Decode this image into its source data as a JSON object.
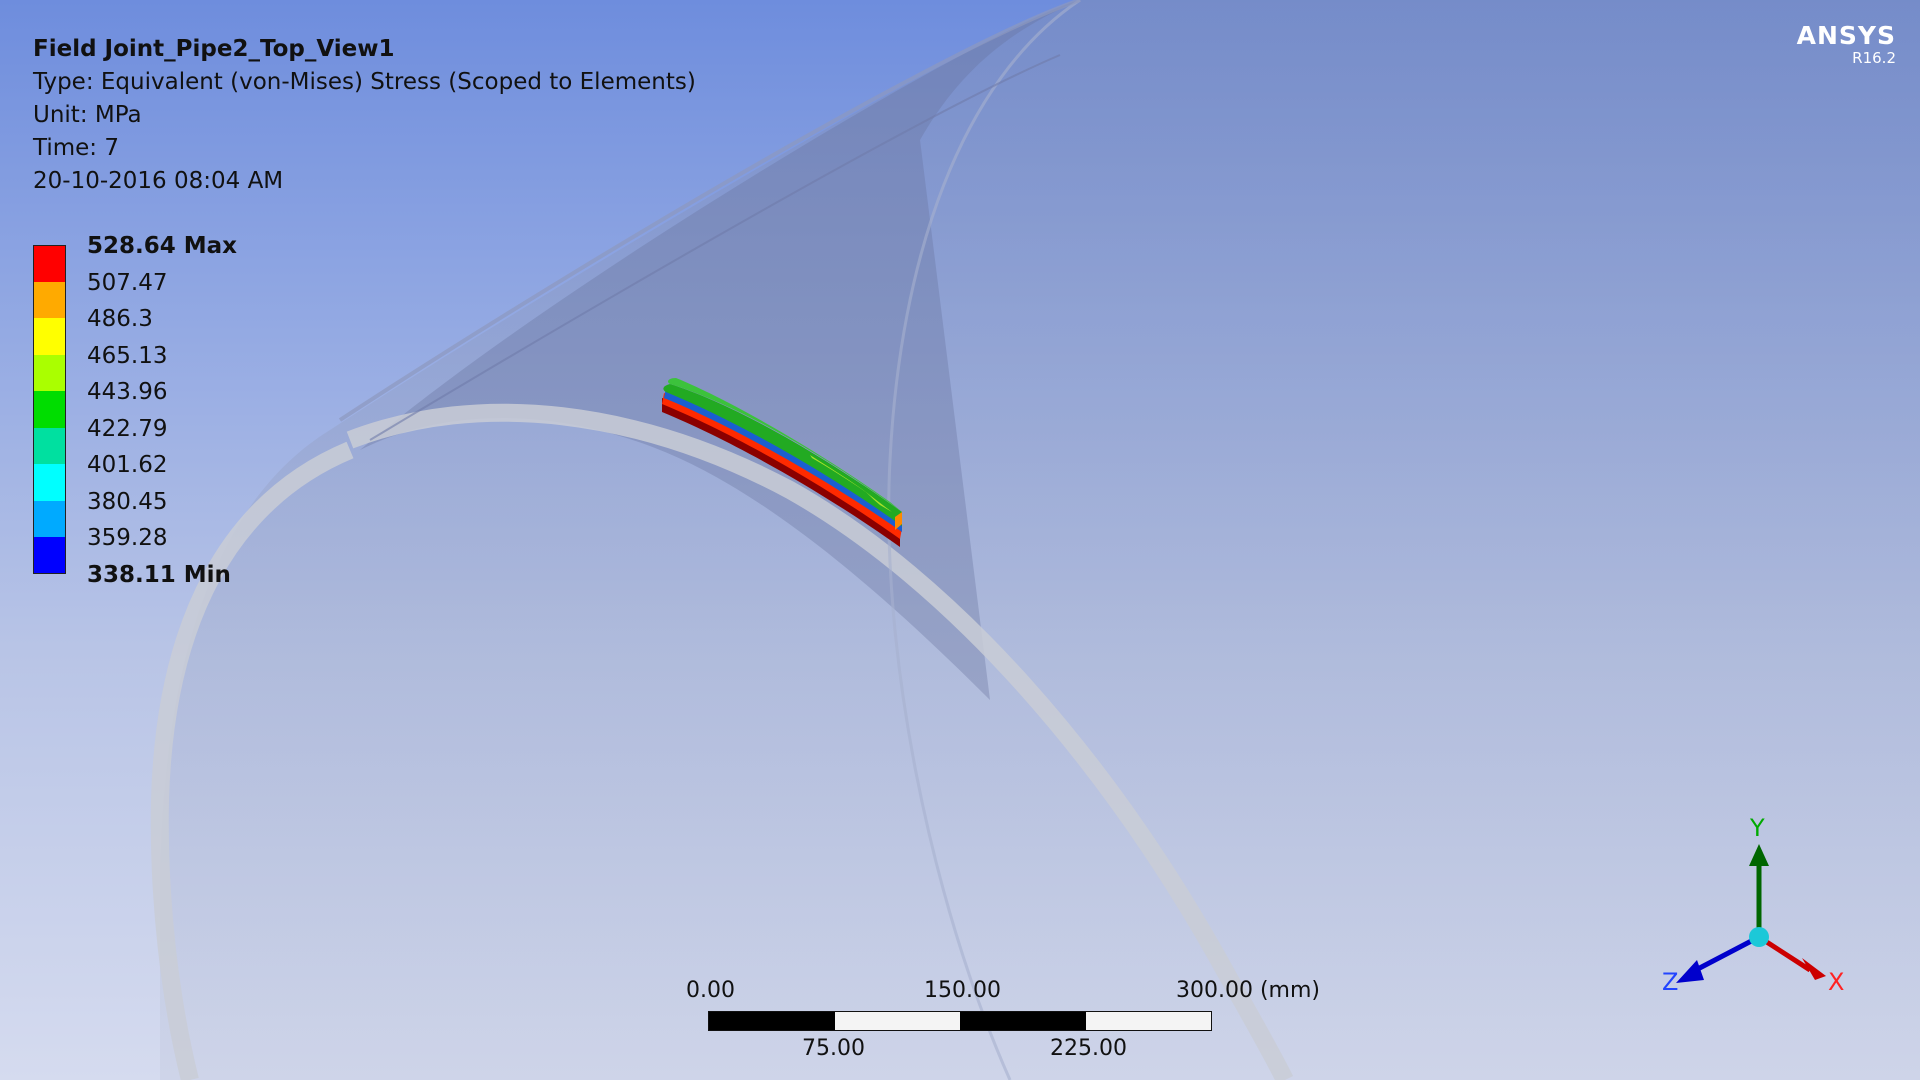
{
  "app": {
    "brand": "ANSYS",
    "version": "R16.2"
  },
  "result_info": {
    "title": "Field Joint_Pipe2_Top_View1",
    "type": "Type: Equivalent (von-Mises) Stress (Scoped to Elements)",
    "unit": "Unit: MPa",
    "time": "Time: 7",
    "timestamp": "20-10-2016 08:04 AM"
  },
  "legend": {
    "max_label": "528.64 Max",
    "min_label": "338.11 Min",
    "values": [
      "528.64 Max",
      "507.47",
      "486.3",
      "465.13",
      "443.96",
      "422.79",
      "401.62",
      "380.45",
      "359.28",
      "338.11 Min"
    ],
    "colors": [
      "#ff0000",
      "#ffaa00",
      "#ffff00",
      "#aaff00",
      "#00dd00",
      "#00e0a0",
      "#00ffff",
      "#00aaff",
      "#0000ff"
    ]
  },
  "scale_bar": {
    "top_labels": [
      "0.00",
      "150.00",
      "300.00 (mm)"
    ],
    "bottom_labels": [
      "75.00",
      "225.00"
    ]
  },
  "triad": {
    "x_label": "X",
    "y_label": "Y",
    "z_label": "Z",
    "x_color": "#cc0000",
    "y_color": "#006600",
    "z_color": "#0000cc"
  }
}
